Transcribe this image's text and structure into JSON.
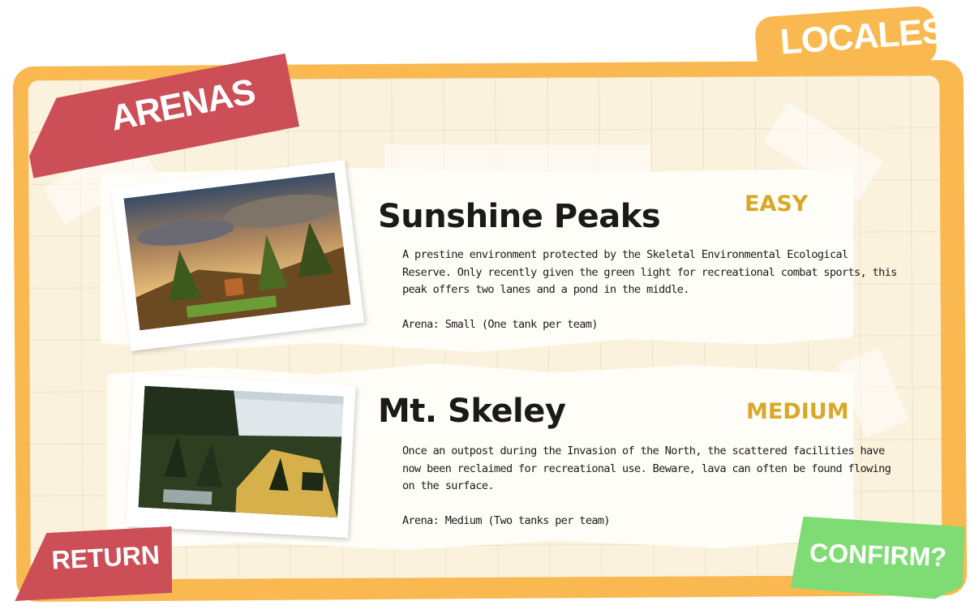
{
  "header": {
    "section_label": "ARENAS",
    "category_label": "LOCALES"
  },
  "arenas": [
    {
      "name": "Sunshine Peaks",
      "difficulty": "EASY",
      "description_lines": [
        "A prestine environment protected by the Skeletal Environmental Ecological",
        "Reserve. Only recently given the green light for recreational combat sports, this",
        "peak offers two lanes and a pond in the middle."
      ],
      "size": "Arena: Small (One tank per team)"
    },
    {
      "name": "Mt. Skeley",
      "difficulty": "MEDIUM",
      "description_lines": [
        "Once an outpost during the Invasion of the North, the scattered facilities have",
        "now been reclaimed for recreational use. Beware, lava can often be found flowing",
        "on the surface."
      ],
      "size": "Arena: Medium (Two tanks per team)"
    }
  ],
  "buttons": {
    "return_label": "RETURN",
    "confirm_label": "CONFIRM?"
  },
  "colors": {
    "board": "#f9b950",
    "paper": "#fbf2dd",
    "red_banner": "#cc4f57",
    "green_button": "#7fdc74",
    "difficulty_gold": "#d9a82a"
  }
}
